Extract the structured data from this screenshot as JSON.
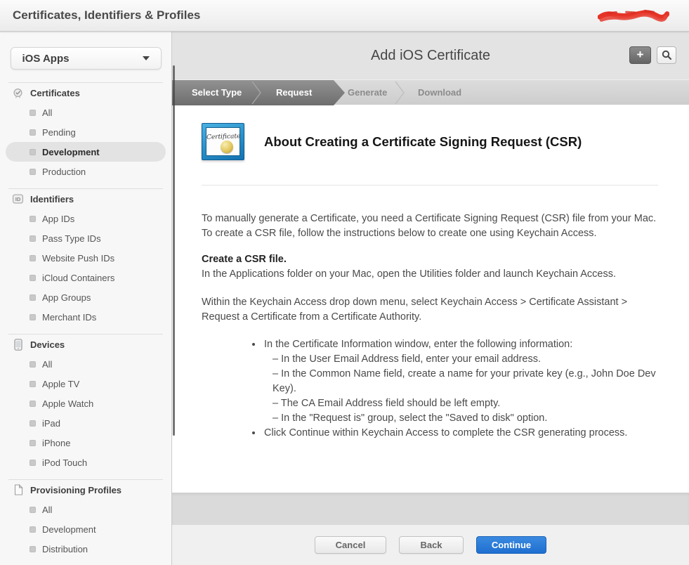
{
  "topbar": {
    "title": "Certificates, Identifiers & Profiles",
    "redacted_username": "redacted"
  },
  "sidebar": {
    "dropdown": {
      "label": "iOS Apps",
      "icon": "chevron-down"
    },
    "sections": [
      {
        "label": "Certificates",
        "icon": "seal-check",
        "items": [
          {
            "label": "All",
            "selected": false
          },
          {
            "label": "Pending",
            "selected": false
          },
          {
            "label": "Development",
            "selected": true
          },
          {
            "label": "Production",
            "selected": false
          }
        ]
      },
      {
        "label": "Identifiers",
        "icon": "id-badge",
        "items": [
          {
            "label": "App IDs",
            "selected": false
          },
          {
            "label": "Pass Type IDs",
            "selected": false
          },
          {
            "label": "Website Push IDs",
            "selected": false
          },
          {
            "label": "iCloud Containers",
            "selected": false
          },
          {
            "label": "App Groups",
            "selected": false
          },
          {
            "label": "Merchant IDs",
            "selected": false
          }
        ]
      },
      {
        "label": "Devices",
        "icon": "iphone-outline",
        "items": [
          {
            "label": "All",
            "selected": false
          },
          {
            "label": "Apple TV",
            "selected": false
          },
          {
            "label": "Apple Watch",
            "selected": false
          },
          {
            "label": "iPad",
            "selected": false
          },
          {
            "label": "iPhone",
            "selected": false
          },
          {
            "label": "iPod Touch",
            "selected": false
          }
        ]
      },
      {
        "label": "Provisioning Profiles",
        "icon": "document",
        "items": [
          {
            "label": "All",
            "selected": false
          },
          {
            "label": "Development",
            "selected": false
          },
          {
            "label": "Distribution",
            "selected": false
          }
        ]
      }
    ]
  },
  "main": {
    "title": "Add iOS Certificate",
    "toolbar": {
      "add_label": "+",
      "add_icon": "plus",
      "search_icon": "magnifier"
    },
    "steps": [
      {
        "label": "Select Type",
        "state": "done"
      },
      {
        "label": "Request",
        "state": "active"
      },
      {
        "label": "Generate",
        "state": "upcoming"
      },
      {
        "label": "Download",
        "state": "upcoming"
      }
    ],
    "article": {
      "icon_word": "Certificate",
      "heading": "About Creating a Certificate Signing Request (CSR)",
      "intro": "To manually generate a Certificate, you need a Certificate Signing Request (CSR) file from your Mac. To create a CSR file, follow the instructions below to create one using Keychain Access.",
      "subheading": "Create a CSR file.",
      "sub_text": "In the Applications folder on your Mac, open the Utilities folder and launch Keychain Access.",
      "para2": "Within the Keychain Access drop down menu, select Keychain Access > Certificate Assistant > Request a Certificate from a Certificate Authority.",
      "bullets": [
        {
          "text": "In the Certificate Information window, enter the following information:",
          "subitems": [
            "– In the User Email Address field, enter your email address.",
            "– In the Common Name field, create a name for your private key (e.g., John Doe Dev Key).",
            "– The CA Email Address field should be left empty.",
            "– In the \"Request is\" group, select the \"Saved to disk\" option."
          ]
        },
        {
          "text": "Click Continue within Keychain Access to complete the CSR generating process.",
          "subitems": []
        }
      ]
    },
    "footer": {
      "cancel": "Cancel",
      "back": "Back",
      "continue": "Continue"
    }
  },
  "colors": {
    "accent_blue": "#2a7ad2",
    "step_dark": "#7a7a7a",
    "redaction_red": "#e63327",
    "cert_icon_blue": "#1272b0",
    "seal_gold": "#e2c75f"
  }
}
